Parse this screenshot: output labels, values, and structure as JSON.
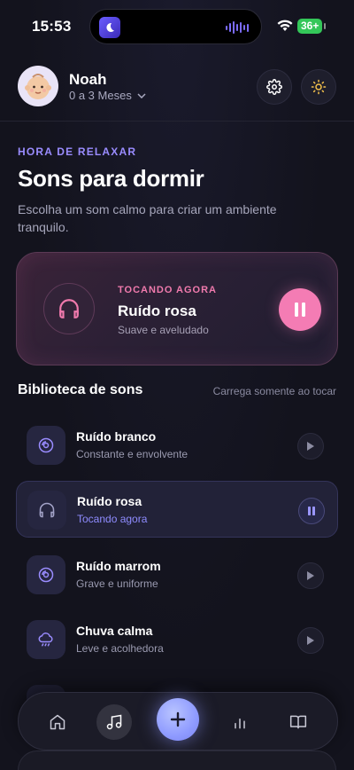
{
  "status_bar": {
    "time": "15:53",
    "battery": "36+",
    "battery_color": "#34c759"
  },
  "profile": {
    "name": "Noah",
    "age_range": "0 a 3 Meses"
  },
  "header_actions": {
    "settings_icon": "gear-icon",
    "theme_icon": "sun-icon"
  },
  "hero": {
    "eyebrow": "HORA DE RELAXAR",
    "title": "Sons para dormir",
    "subtitle": "Escolha um som calmo para criar um ambiente tranquilo."
  },
  "now_playing": {
    "eyebrow": "TOCANDO AGORA",
    "title": "Ruído rosa",
    "subtitle": "Suave e aveludado",
    "accent": "#f47cb4"
  },
  "library": {
    "title": "Biblioteca de sons",
    "note": "Carrega somente ao tocar",
    "items": [
      {
        "title": "Ruído branco",
        "subtitle": "Constante e envolvente",
        "icon": "disc-icon",
        "active": false
      },
      {
        "title": "Ruído rosa",
        "subtitle": "Tocando agora",
        "icon": "headphones-icon",
        "active": true
      },
      {
        "title": "Ruído marrom",
        "subtitle": "Grave e uniforme",
        "icon": "disc-icon",
        "active": false
      },
      {
        "title": "Chuva calma",
        "subtitle": "Leve e acolhedora",
        "icon": "rain-cloud-icon",
        "active": false
      }
    ]
  },
  "bottom_nav": {
    "items": [
      "home-icon",
      "music-note-icon",
      "plus-icon",
      "bar-chart-icon",
      "book-icon"
    ],
    "active": "music-note-icon"
  },
  "colors": {
    "background": "#13131d",
    "accent_purple": "#9a8cff",
    "accent_pink": "#f47cb4"
  }
}
